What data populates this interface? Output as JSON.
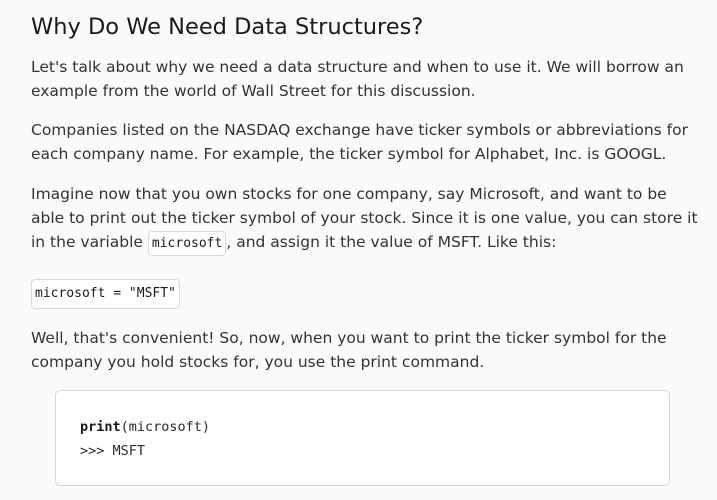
{
  "heading": "Why Do We Need Data Structures?",
  "paragraphs": {
    "p1": "Let's talk about why we need a data structure and when to use it. We will borrow an example from the world of Wall Street for this discussion.",
    "p2": "Companies listed on the NASDAQ exchange have ticker symbols or abbreviations for each company name. For example, the ticker symbol for Alphabet, Inc. is GOOGL.",
    "p3_before": "Imagine now that you own stocks for one company, say Microsoft, and want to be able to print out the ticker symbol of your stock. Since it is one value, you can store it in the variable ",
    "p3_code": "microsoft",
    "p3_after": ", and assign it the value of MSFT. Like this:",
    "p4": "Well, that's convenient! So, now, when you want to print the ticker symbol for the company you hold stocks for, you use the print command."
  },
  "snippet": "microsoft = \"MSFT\"",
  "code_block": {
    "keyword": "print",
    "call_args": "(microsoft)",
    "output": ">>> MSFT"
  }
}
